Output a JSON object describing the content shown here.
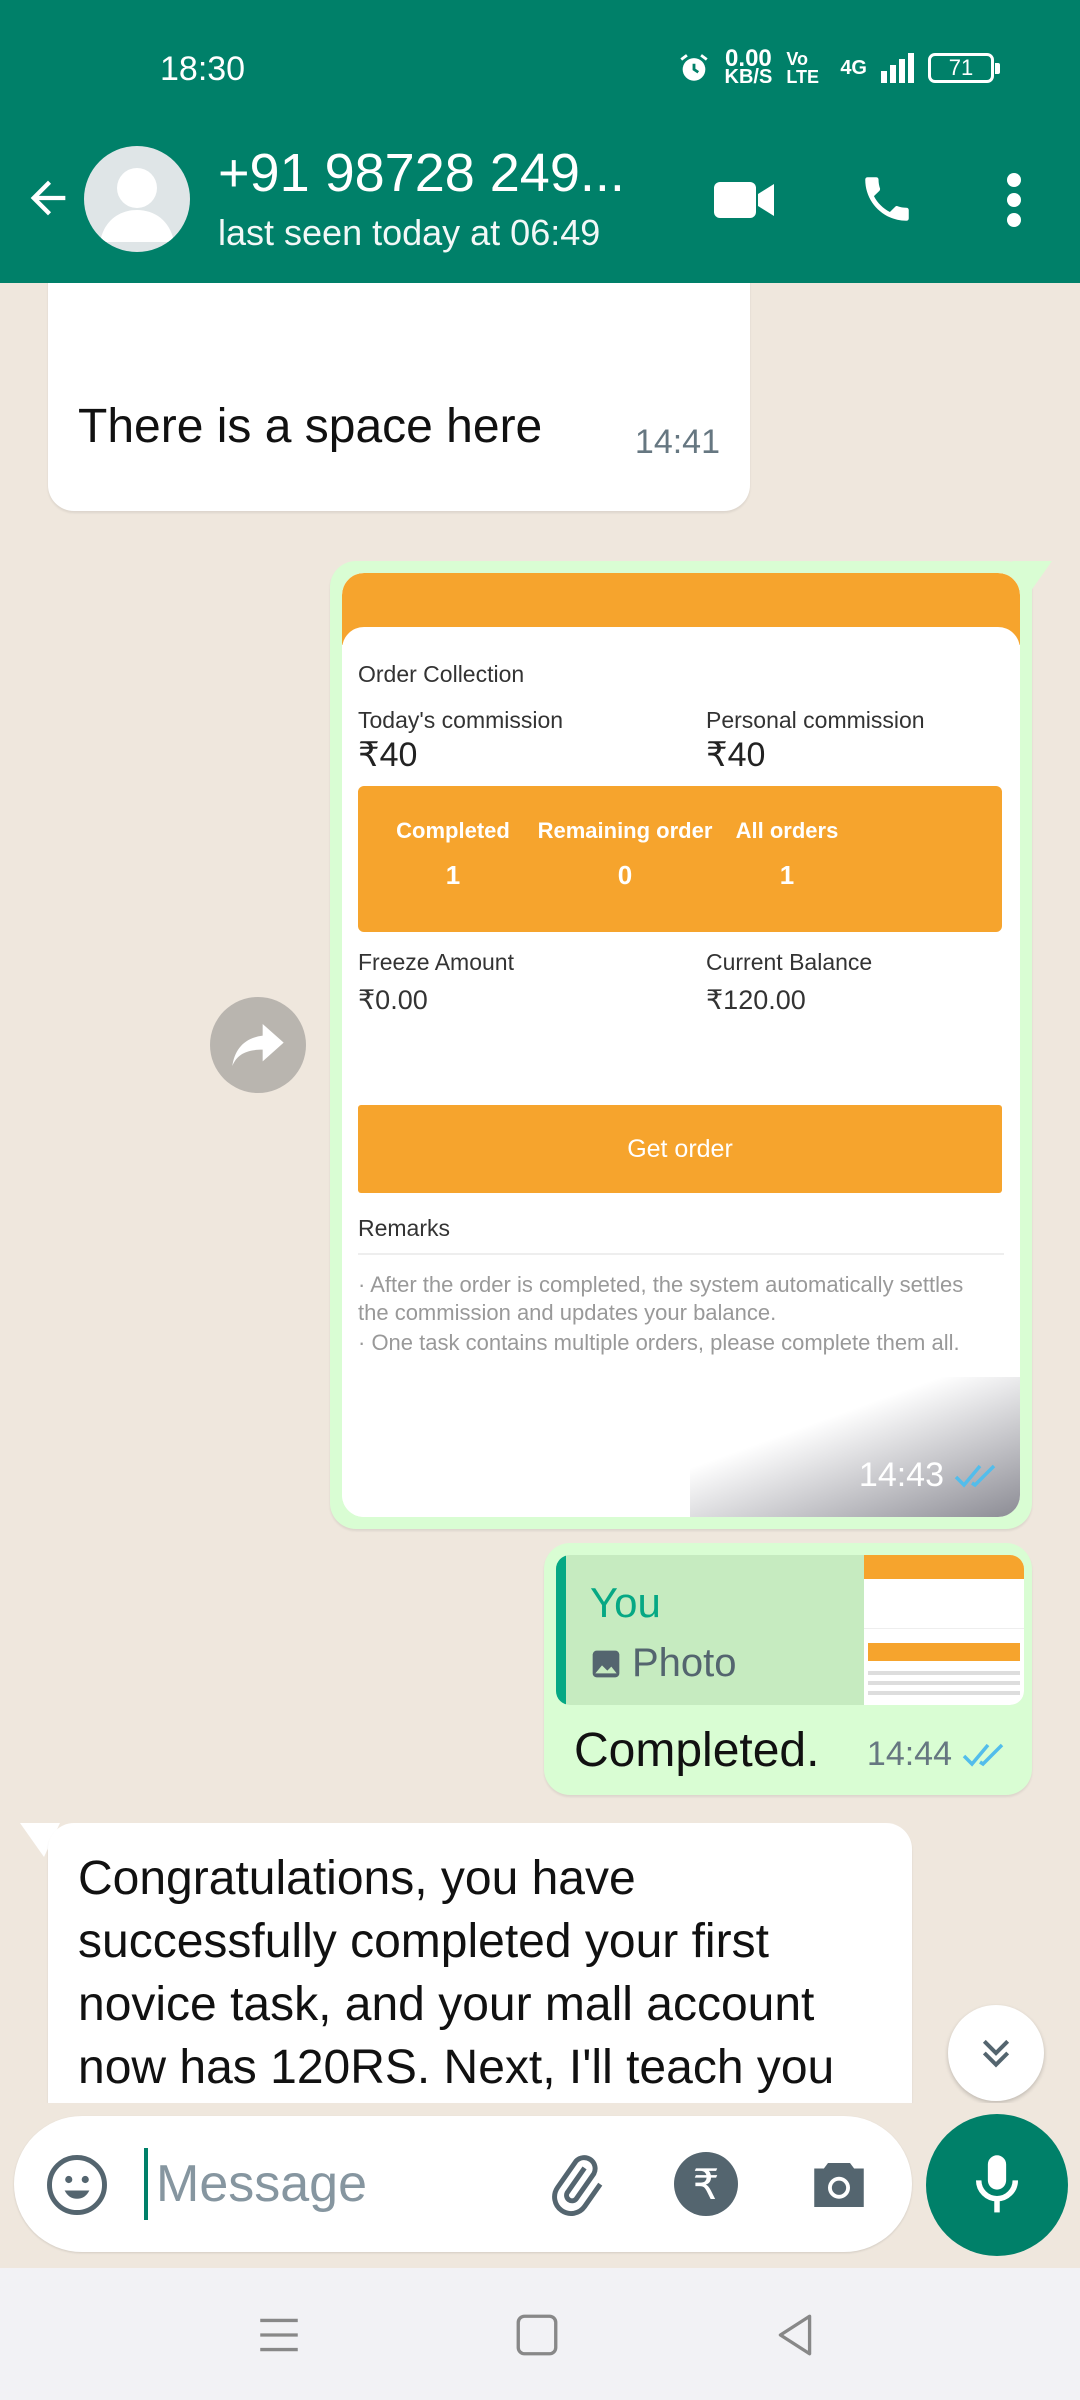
{
  "status_bar": {
    "time": "18:30",
    "net_speed": "0.00",
    "net_unit": "KB/S",
    "volte": "Vo LTE",
    "network": "4G",
    "battery": "71"
  },
  "header": {
    "contact": "+91 98728 249...",
    "last_seen": "last seen today at 06:49",
    "color": "#008069"
  },
  "messages": {
    "m1": {
      "text": "There is a space here",
      "time": "14:41"
    },
    "m2": {
      "time": "14:43",
      "screenshot": {
        "title": "Order Collection",
        "todays_commission_label": "Today's commission",
        "todays_commission_value": "₹40",
        "personal_commission_label": "Personal commission",
        "personal_commission_value": "₹40",
        "stats": [
          {
            "label": "Completed",
            "value": "1"
          },
          {
            "label": "Remaining order",
            "value": "0"
          },
          {
            "label": "All orders",
            "value": "1"
          }
        ],
        "freeze_label": "Freeze Amount",
        "freeze_value": "₹0.00",
        "balance_label": "Current Balance",
        "balance_value": "₹120.00",
        "button": "Get order",
        "remarks_title": "Remarks",
        "remark_1": "· After the order is completed, the system automatically settles the commission and updates your balance.",
        "remark_2": "· One task contains multiple orders, please complete them all.",
        "accent": "#f6a42d"
      }
    },
    "m3": {
      "quote_author": "You",
      "quote_type": "Photo",
      "text": "Completed.",
      "time": "14:44"
    },
    "m4": {
      "text": "Congratulations, you have successfully completed your first novice task, and your mall account now has 120RS. Next, I'll teach you"
    }
  },
  "composer": {
    "placeholder": "Message"
  },
  "icons": [
    "back-arrow-icon",
    "video-call-icon",
    "voice-call-icon",
    "more-options-icon",
    "forward-icon",
    "scroll-down-icon",
    "emoji-icon",
    "attach-icon",
    "rupee-icon",
    "camera-icon",
    "mic-icon"
  ]
}
